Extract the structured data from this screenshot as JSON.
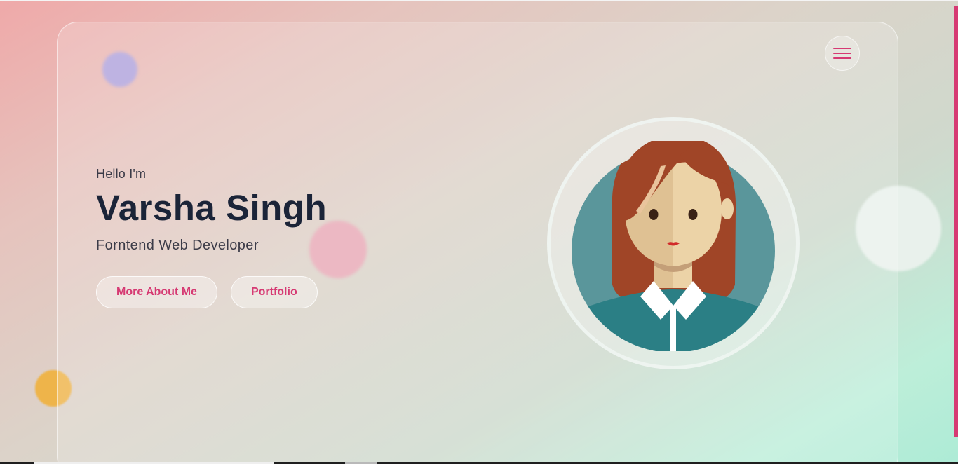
{
  "menu": {
    "icon": "hamburger-menu-icon"
  },
  "hero": {
    "greeting": "Hello I'm",
    "name": "Varsha Singh",
    "role": "Forntend Web Developer",
    "buttons": [
      {
        "label": "More About Me"
      },
      {
        "label": "Portfolio"
      }
    ]
  },
  "avatar": {
    "icon": "woman-avatar-illustration"
  },
  "colors": {
    "accent": "#d63a73",
    "heading": "#1b2438",
    "avatar_background": "#5a969b",
    "hair": "#a04527",
    "shirt": "#2b7f85"
  }
}
